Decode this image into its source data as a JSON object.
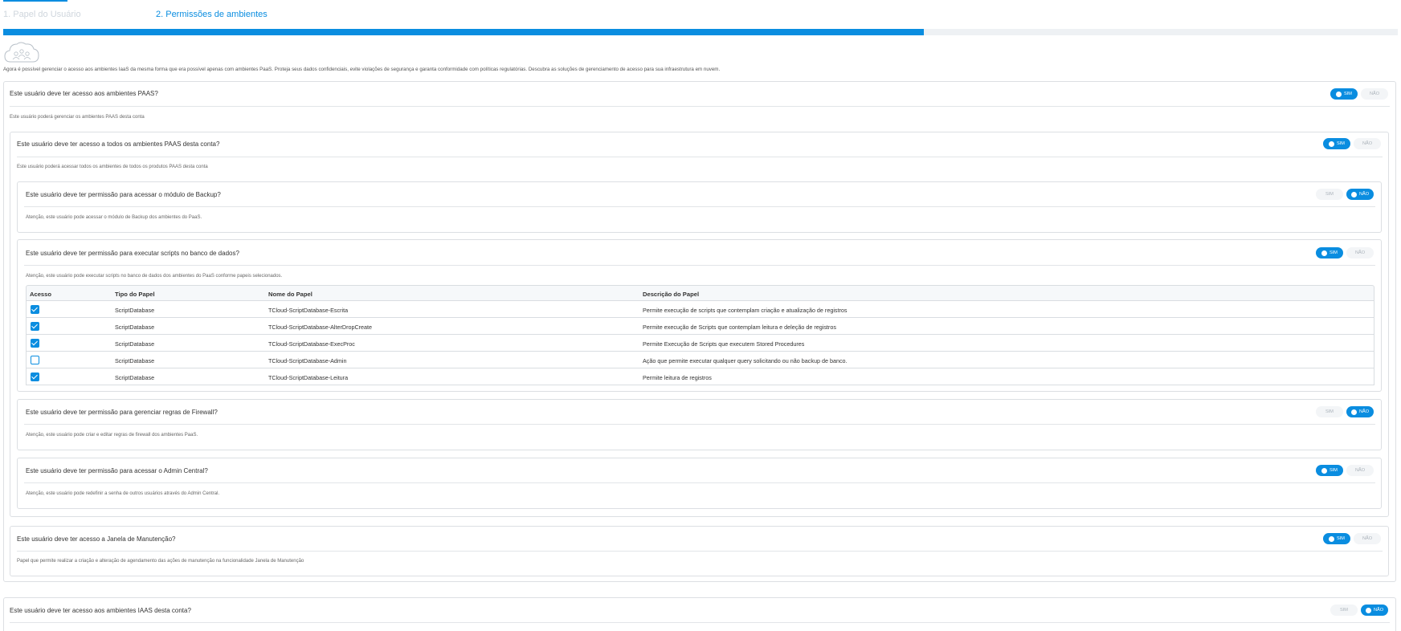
{
  "tabs": [
    {
      "label": "1. Papel do Usuário"
    },
    {
      "label": "2. Permissões de ambientes"
    }
  ],
  "progress": {
    "percent": 66
  },
  "intro": {
    "text": "Agora é possível gerenciar o acesso aos ambientes IaaS da mesma forma que era possível apenas com ambientes PaaS. Proteja seus dados confidenciais, evite violações de segurança e garanta conformidade com políticas regulatórias. Descubra as soluções de gerenciamento de acesso para sua infraestrutura em nuvem."
  },
  "toggle_labels": {
    "sim": "SIM",
    "nao": "NÃO"
  },
  "paas": {
    "question": "Este usuário deve ter acesso aos ambientes PAAS?",
    "description": "Este usuário poderá gerenciar os ambientes PAAS desta conta",
    "value": "SIM"
  },
  "all_paas": {
    "question": "Este usuário deve ter acesso a todos os ambientes PAAS desta conta?",
    "description": "Este usuário poderá acessar todos os ambientes de todos os produtos PAAS desta conta",
    "value": "SIM"
  },
  "backup": {
    "question": "Este usuário deve ter permissão para acessar o módulo de Backup?",
    "description": "Atenção, este usuário pode acessar o módulo de Backup dos ambientes do PaaS.",
    "value": "NÃO"
  },
  "scripts": {
    "question": "Este usuário deve ter permissão para executar scripts no banco de dados?",
    "description": "Atenção, este usuário pode executar scripts no banco de dados dos ambientes do PaaS conforme papeis selecionados.",
    "value": "SIM",
    "table": {
      "headers": [
        "Acesso",
        "Tipo do Papel",
        "Nome do Papel",
        "Descrição do Papel"
      ],
      "rows": [
        {
          "checked": true,
          "tipo": "ScriptDatabase",
          "nome": "TCloud-ScriptDatabase-Escrita",
          "descricao": "Permite execução de scripts que contemplam criação e atualização de registros"
        },
        {
          "checked": true,
          "tipo": "ScriptDatabase",
          "nome": "TCloud-ScriptDatabase-AlterDropCreate",
          "descricao": "Permite execução de Scripts que contemplam leitura e deleção de registros"
        },
        {
          "checked": true,
          "tipo": "ScriptDatabase",
          "nome": "TCloud-ScriptDatabase-ExecProc",
          "descricao": "Permite Execução de Scripts que executem Stored Procedures"
        },
        {
          "checked": false,
          "tipo": "ScriptDatabase",
          "nome": "TCloud-ScriptDatabase-Admin",
          "descricao": "Ação que permite executar qualquer query solicitando ou não backup de banco."
        },
        {
          "checked": true,
          "tipo": "ScriptDatabase",
          "nome": "TCloud-ScriptDatabase-Leitura",
          "descricao": "Permite leitura de registros"
        }
      ]
    }
  },
  "firewall": {
    "question": "Este usuário deve ter permissão para gerenciar regras de Firewall?",
    "description": "Atenção, este usuário pode criar e editar regras de firewall dos ambientes PaaS.",
    "value": "NÃO"
  },
  "admin_central": {
    "question": "Este usuário deve ter permissão para acessar o Admin Central?",
    "description": "Atenção, este usuário pode redefinir a senha de outros usuários através do Admin Central.",
    "value": "SIM"
  },
  "maintenance": {
    "question": "Este usuário deve ter acesso a Janela de Manutenção?",
    "description": "Papel que permite realizar a criação e alteração de agendamento das ações de manutenção na funcionalidade Janela de Manutenção",
    "value": "SIM"
  },
  "iaas": {
    "question": "Este usuário deve ter acesso aos ambientes IAAS desta conta?",
    "value": "NÃO"
  },
  "colors": {
    "accent": "#0a8de0",
    "border": "#dcdfe3"
  },
  "icons": [
    "cloud-users-icon",
    "check-icon"
  ]
}
